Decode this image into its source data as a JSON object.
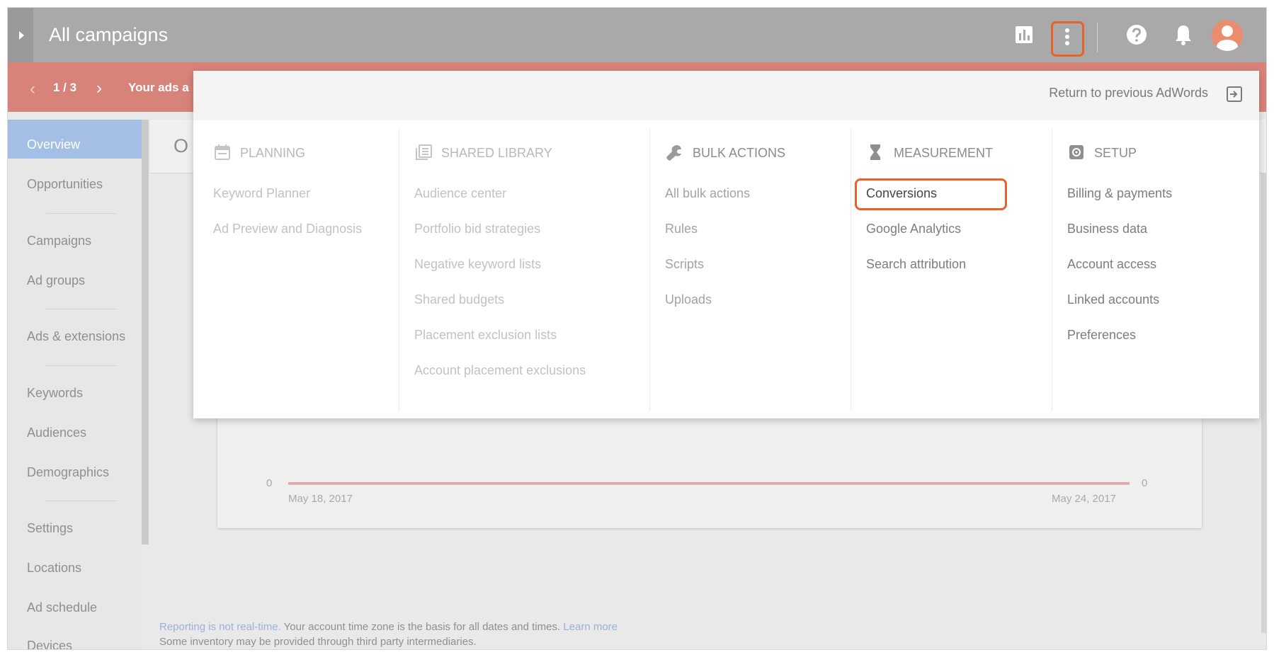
{
  "header": {
    "title": "All campaigns",
    "icons": [
      "reports-icon",
      "more-vert-icon",
      "help-icon",
      "notifications-icon",
      "account-avatar"
    ]
  },
  "alert": {
    "counter": "1 / 3",
    "text": "Your ads a"
  },
  "sidebar": {
    "items": [
      {
        "label": "Overview"
      },
      {
        "label": "Opportunities"
      },
      {
        "label": "Campaigns"
      },
      {
        "label": "Ad groups"
      },
      {
        "label": "Ads & extensions"
      },
      {
        "label": "Keywords"
      },
      {
        "label": "Audiences"
      },
      {
        "label": "Demographics"
      },
      {
        "label": "Settings"
      },
      {
        "label": "Locations"
      },
      {
        "label": "Ad schedule"
      },
      {
        "label": "Devices"
      }
    ],
    "active": "Overview"
  },
  "main": {
    "header_letter": "O",
    "chart": {
      "y_left": "0",
      "y_right": "0",
      "x_start": "May 18, 2017",
      "x_end": "May 24, 2017"
    },
    "footer": {
      "part1": "Reporting is not real-time.",
      "part2": " Your account time zone is the basis for all dates and times. ",
      "learn_more": "Learn more",
      "line2": "Some inventory may be provided through third party intermediaries."
    }
  },
  "menu": {
    "return_label": "Return to previous AdWords",
    "columns": [
      {
        "title": "PLANNING",
        "icon": "calendar-icon",
        "items": [
          "Keyword Planner",
          "Ad Preview and Diagnosis"
        ]
      },
      {
        "title": "SHARED LIBRARY",
        "icon": "library-icon",
        "items": [
          "Audience center",
          "Portfolio bid strategies",
          "Negative keyword lists",
          "Shared budgets",
          "Placement exclusion lists",
          "Account placement exclusions"
        ]
      },
      {
        "title": "BULK ACTIONS",
        "icon": "wrench-icon",
        "items": [
          "All bulk actions",
          "Rules",
          "Scripts",
          "Uploads"
        ]
      },
      {
        "title": "MEASUREMENT",
        "icon": "hourglass-icon",
        "items": [
          "Conversions",
          "Google Analytics",
          "Search attribution"
        ],
        "highlighted": "Conversions"
      },
      {
        "title": "SETUP",
        "icon": "settings-icon",
        "items": [
          "Billing & payments",
          "Business data",
          "Account access",
          "Linked accounts",
          "Preferences"
        ]
      }
    ]
  },
  "colors": {
    "highlight": "#e8622a",
    "alert": "#d8837a",
    "sidebar_active": "#a3bfe6",
    "chart_line": "#e6a5a0"
  }
}
